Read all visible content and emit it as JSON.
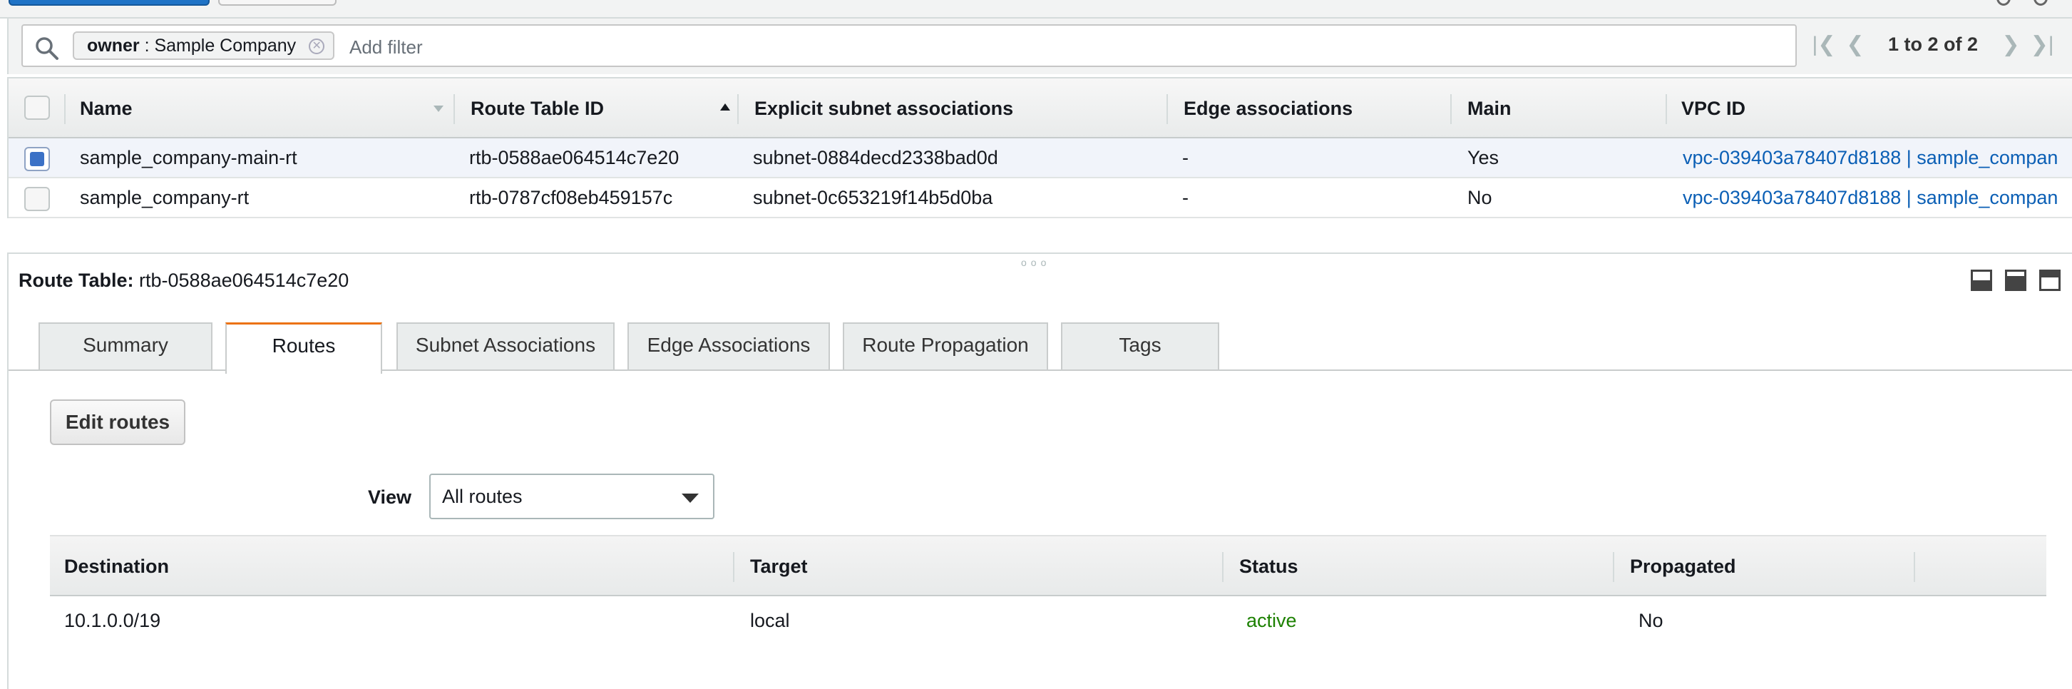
{
  "filter": {
    "token_key": "owner",
    "token_sep": " : ",
    "token_value": "Sample Company",
    "placeholder": "Add filter"
  },
  "pagination": {
    "text": "1 to 2 of 2"
  },
  "route_tables": {
    "columns": [
      "Name",
      "Route Table ID",
      "Explicit subnet associations",
      "Edge associations",
      "Main",
      "VPC ID"
    ],
    "rows": [
      {
        "selected": true,
        "name": "sample_company-main-rt",
        "route_table_id": "rtb-0588ae064514c7e20",
        "subnet": "subnet-0884decd2338bad0d",
        "edge": "-",
        "main": "Yes",
        "vpc": "vpc-039403a78407d8188 | sample_compan"
      },
      {
        "selected": false,
        "name": "sample_company-rt",
        "route_table_id": "rtb-0787cf08eb459157c",
        "subnet": "subnet-0c653219f14b5d0ba",
        "edge": "-",
        "main": "No",
        "vpc": "vpc-039403a78407d8188 | sample_compan"
      }
    ]
  },
  "detail": {
    "label": "Route Table:",
    "value": "rtb-0588ae064514c7e20",
    "tabs": [
      "Summary",
      "Routes",
      "Subnet Associations",
      "Edge Associations",
      "Route Propagation",
      "Tags"
    ],
    "active_tab": "Routes",
    "edit_button": "Edit routes",
    "view_label": "View",
    "view_selected": "All routes",
    "routes": {
      "columns": [
        "Destination",
        "Target",
        "Status",
        "Propagated"
      ],
      "rows": [
        {
          "destination": "10.1.0.0/19",
          "target": "local",
          "status": "active",
          "propagated": "No"
        }
      ]
    }
  },
  "colors": {
    "link": "#0b5fb5",
    "active_tab": "#ec7211",
    "status_active": "#1d8102",
    "selected_row": "#f1f4fa"
  }
}
